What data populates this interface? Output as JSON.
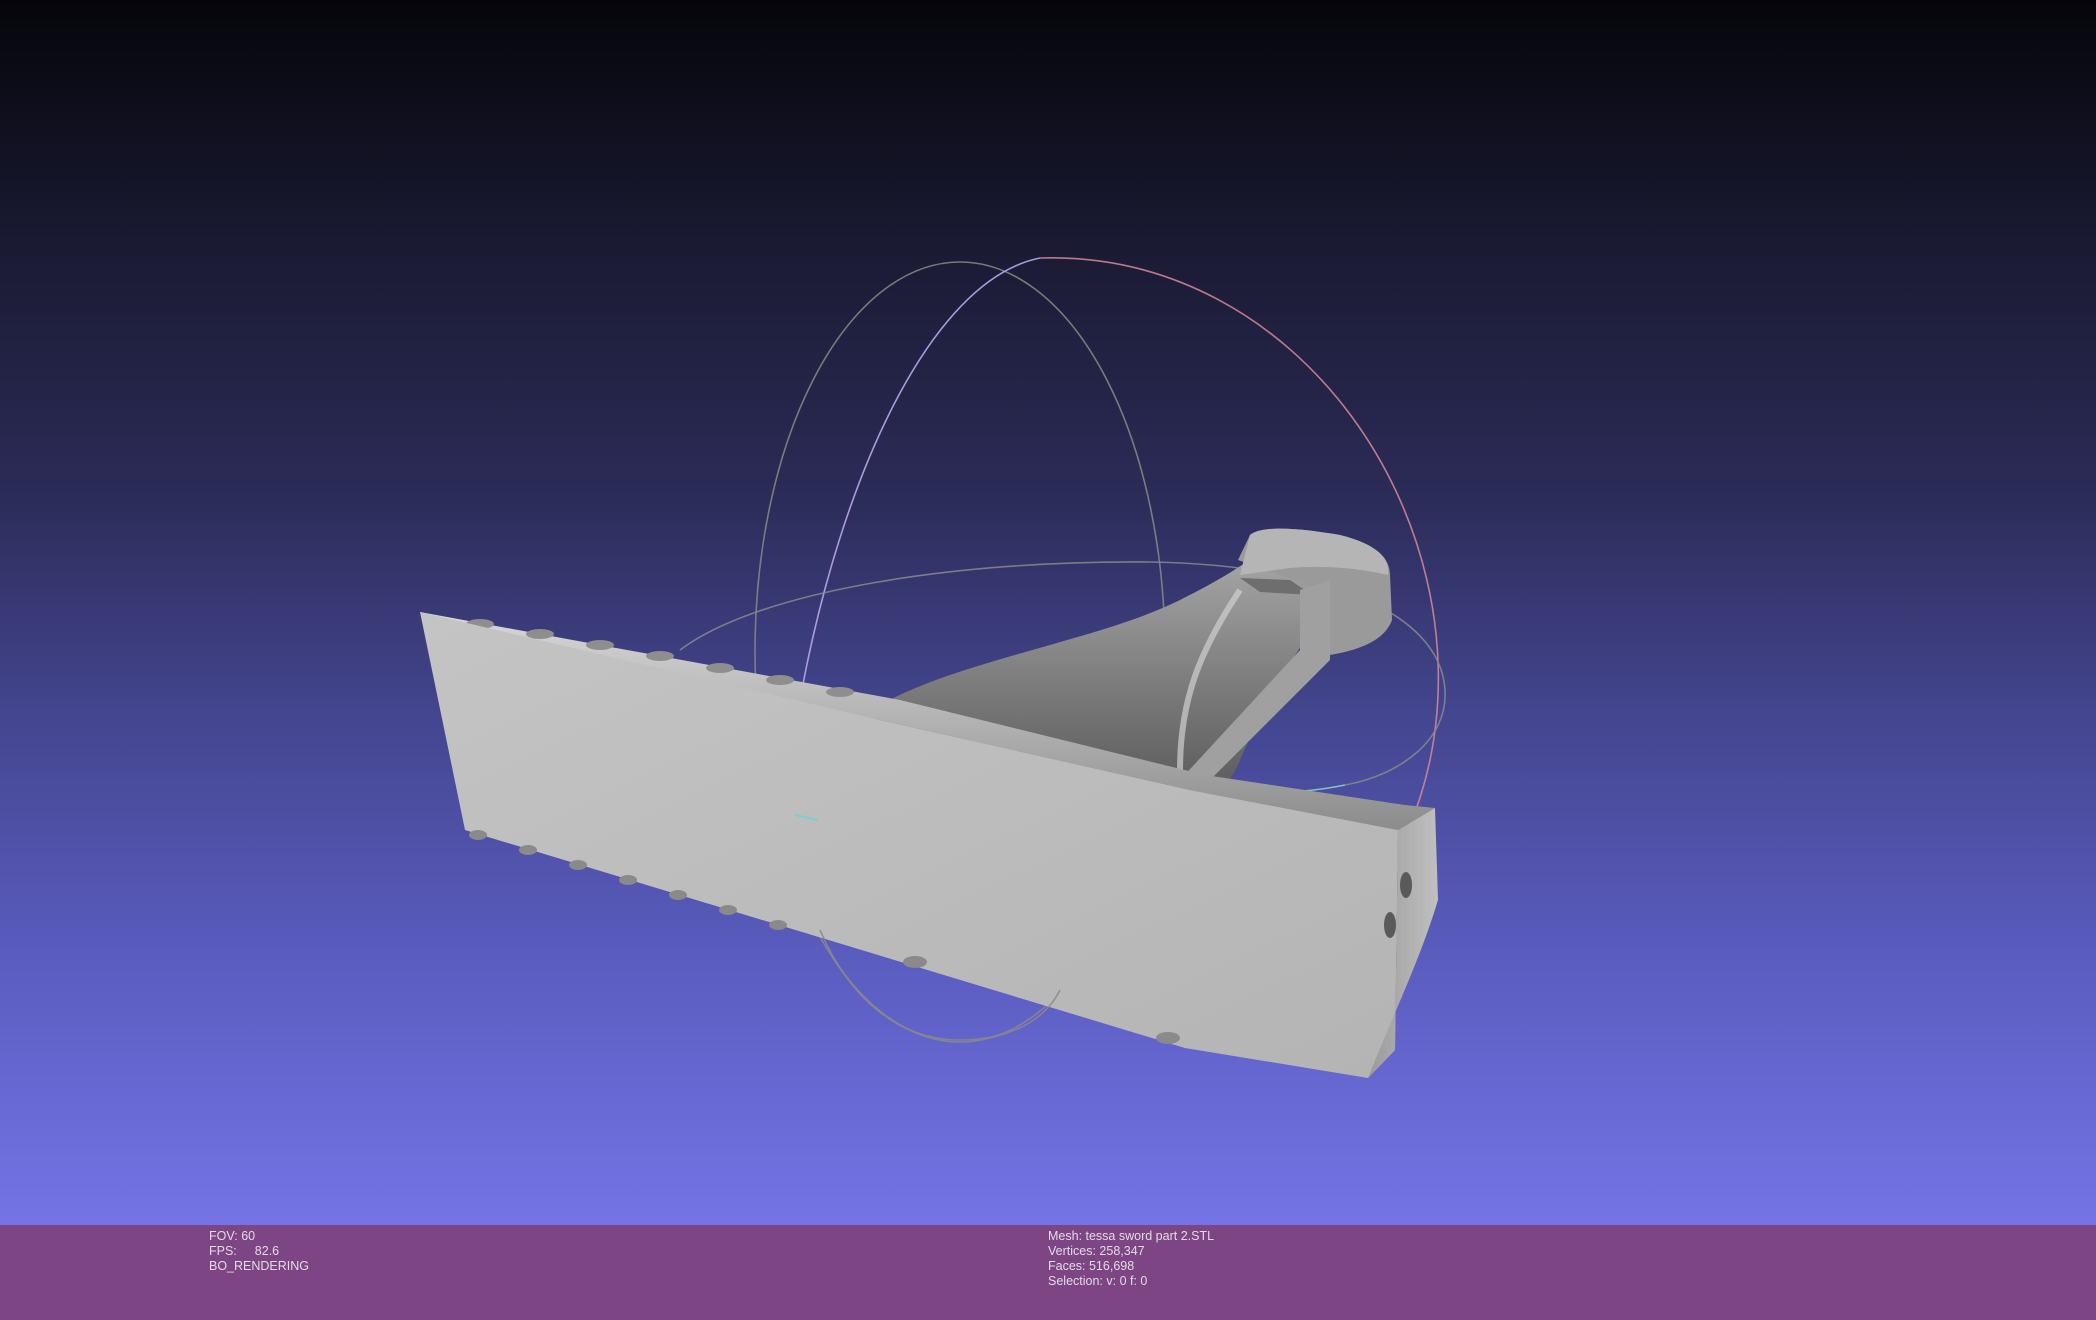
{
  "viewport": {
    "background_top": "#05050a",
    "background_bottom": "#7474e6",
    "mesh_color": "#bfbfbf",
    "trackball_colors": [
      "#8a8a8a",
      "#d98a9a",
      "#b8a8ea",
      "#88d0c8"
    ]
  },
  "status": {
    "fov_label": "FOV:",
    "fov_value": "60",
    "fps_label": "FPS:",
    "fps_value": "82.6",
    "render_mode": "BO_RENDERING"
  },
  "mesh_info": {
    "mesh": "Mesh: tessa sword part 2.STL",
    "vertices": "Vertices: 258,347",
    "faces": "Faces: 516,698",
    "selection": "Selection: v: 0 f: 0"
  },
  "colors": {
    "info_bar_bg": "#7e4585",
    "info_text": "#e2dbe5"
  }
}
